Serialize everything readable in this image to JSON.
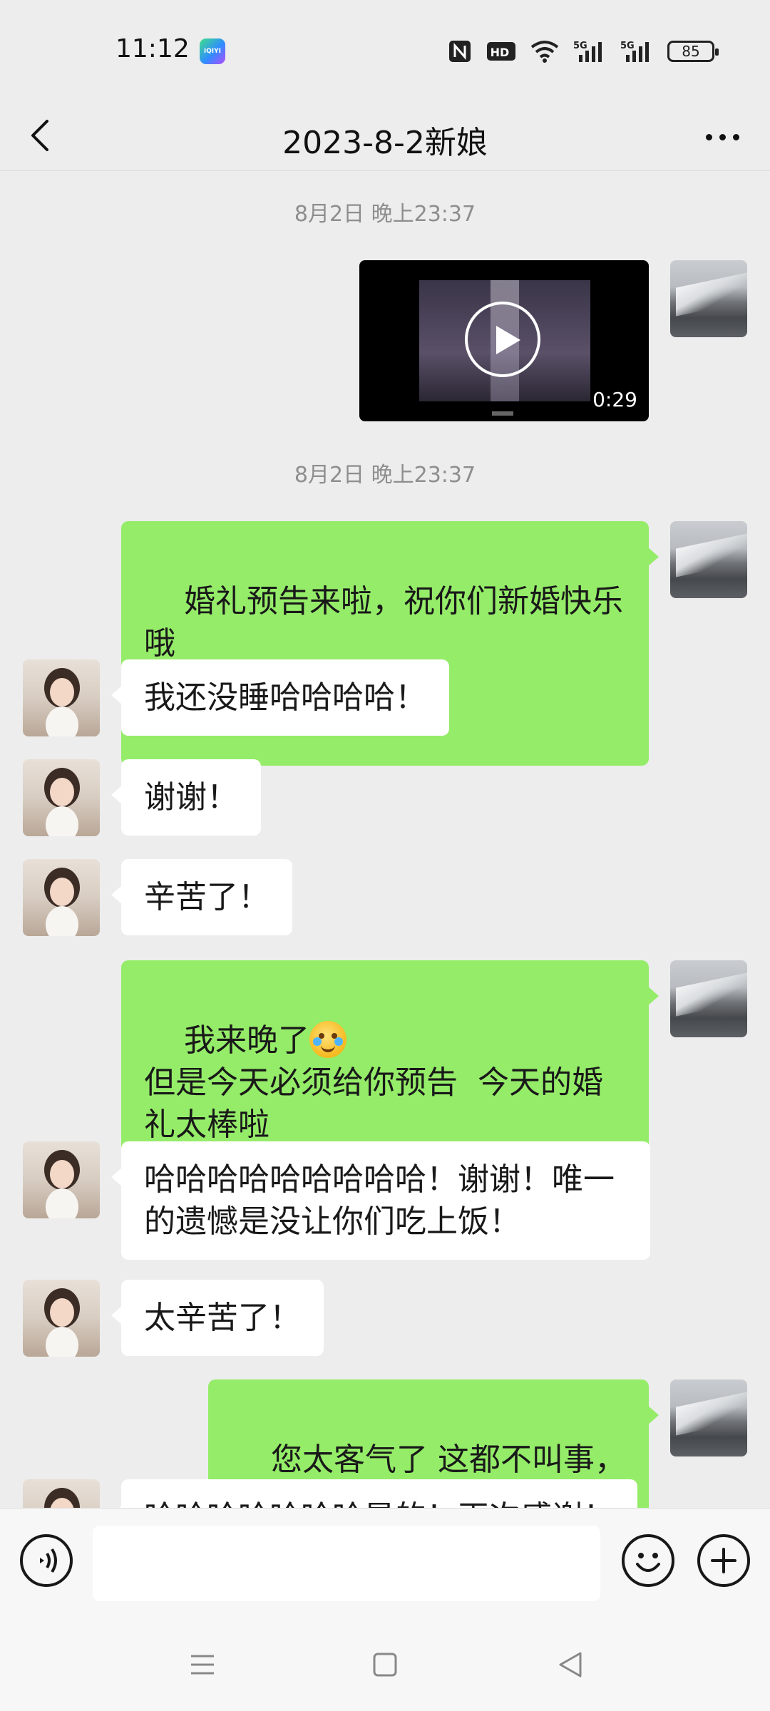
{
  "status_bar": {
    "time": "11:12",
    "app_icon_label": "iQIYI",
    "battery": "85",
    "signal_1": "5G",
    "signal_2": "5G",
    "hd_label": "HD"
  },
  "header": {
    "title": "2023-8-2新娘",
    "back_icon": "chevron-left-icon",
    "more_icon": "more-horizontal-icon"
  },
  "messages": [
    {
      "type": "timestamp",
      "text": "8月2日 晚上23:37"
    },
    {
      "type": "video",
      "from": "me",
      "duration": "0:29"
    },
    {
      "type": "timestamp",
      "text": "8月2日 晚上23:37"
    },
    {
      "type": "text",
      "from": "me",
      "text": "婚礼预告来啦，祝你们新婚快乐哦"
    },
    {
      "type": "text",
      "from": "other",
      "text": "我还没睡哈哈哈哈！"
    },
    {
      "type": "text",
      "from": "other",
      "text": "谢谢！"
    },
    {
      "type": "text",
      "from": "other",
      "text": "辛苦了！"
    },
    {
      "type": "text",
      "from": "me",
      "line1": "我来晚了",
      "text": "但是今天必须给你预告  今天的婚礼太棒啦"
    },
    {
      "type": "text",
      "from": "other",
      "text": "哈哈哈哈哈哈哈哈哈！谢谢！唯一的遗憾是没让你们吃上饭！"
    },
    {
      "type": "text",
      "from": "other",
      "text": "太辛苦了！"
    },
    {
      "type": "text",
      "from": "me",
      "text": "您太客气了 这都不叫事，"
    },
    {
      "type": "text",
      "from": "other",
      "text": "哈哈哈哈哈哈哈是的！再次感谢！"
    }
  ],
  "input_bar": {
    "placeholder": "",
    "voice_icon": "voice-icon",
    "emoji_icon": "emoji-icon",
    "plus_icon": "plus-circle-icon"
  },
  "colors": {
    "background": "#ededed",
    "my_bubble": "#95ec69",
    "other_bubble": "#ffffff",
    "timestamp": "#8e8e8e"
  }
}
